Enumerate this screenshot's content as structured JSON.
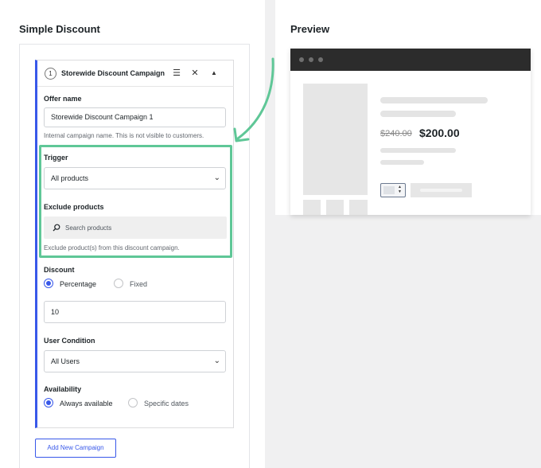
{
  "left_panel": {
    "title": "Simple Discount"
  },
  "campaign": {
    "number": "1",
    "title": "Storewide Discount Campaign 1",
    "header_icons": [
      "menu-icon",
      "close-icon",
      "collapse-icon"
    ],
    "offer_name_label": "Offer name",
    "offer_name_value": "Storewide Discount Campaign 1",
    "offer_name_help": "Internal campaign name. This is not visible to customers.",
    "trigger_label": "Trigger",
    "trigger_value": "All products",
    "exclude_label": "Exclude products",
    "exclude_placeholder": "Search products",
    "exclude_help": "Exclude product(s) from this discount campaign.",
    "discount_label": "Discount",
    "discount_options": [
      {
        "label": "Percentage",
        "selected": true
      },
      {
        "label": "Fixed",
        "selected": false
      }
    ],
    "discount_value": "10",
    "user_condition_label": "User Condition",
    "user_condition_value": "All Users",
    "availability_label": "Availability",
    "availability_options": [
      {
        "label": "Always available",
        "selected": true
      },
      {
        "label": "Specific dates",
        "selected": false
      }
    ]
  },
  "add_button_label": "Add New Campaign",
  "preview": {
    "title": "Preview",
    "old_price": "$240.00",
    "new_price": "$200.00"
  },
  "colors": {
    "accent": "#3858e9",
    "highlight": "#5fc797",
    "browser_bar": "#2c2c2c"
  }
}
